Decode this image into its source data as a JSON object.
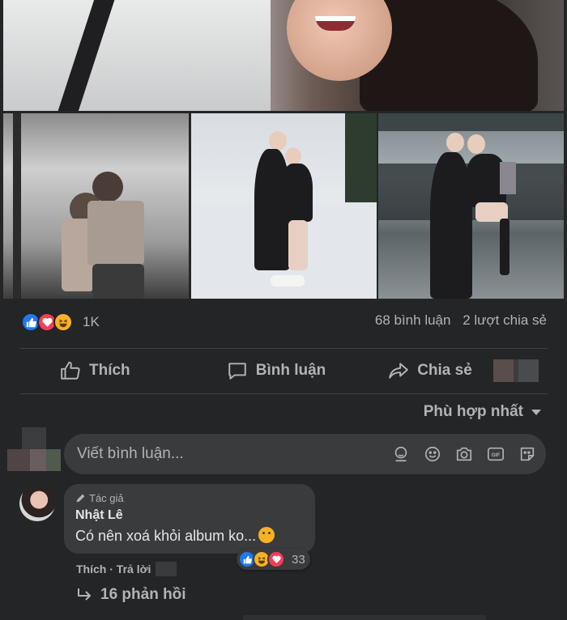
{
  "post": {
    "reactions": {
      "icons": [
        "like-icon",
        "love-icon",
        "haha-icon"
      ],
      "count": "1K"
    },
    "stats": {
      "comments": "68 bình luận",
      "shares": "2 lượt chia sẻ"
    },
    "actions": {
      "like_label": "Thích",
      "comment_label": "Bình luận",
      "share_label": "Chia sẻ"
    },
    "sort_label": "Phù hợp nhất",
    "comment_input": {
      "placeholder": "Viết bình luận...",
      "icons": [
        "sticker-avatar-icon",
        "emoji-icon",
        "camera-icon",
        "gif-icon",
        "sticker-icon"
      ]
    }
  },
  "comment": {
    "author_tag": "Tác giả",
    "author_name": "Nhật Lê",
    "text": "Có nên xoá khỏi album ko...",
    "reactions": {
      "icons": [
        "like-icon",
        "haha-icon",
        "love-icon"
      ],
      "count": "33"
    },
    "like_label": "Thích",
    "reply_label": "Trả lời",
    "replies_label": "16 phản hồi"
  },
  "colors": {
    "background": "#242526",
    "input_background": "#3a3b3c",
    "secondary_text": "#b0b3b8",
    "primary_text": "#e4e6eb",
    "like_blue": "#2078f4",
    "love_red": "#f33e58",
    "haha_yellow": "#f7b125"
  }
}
